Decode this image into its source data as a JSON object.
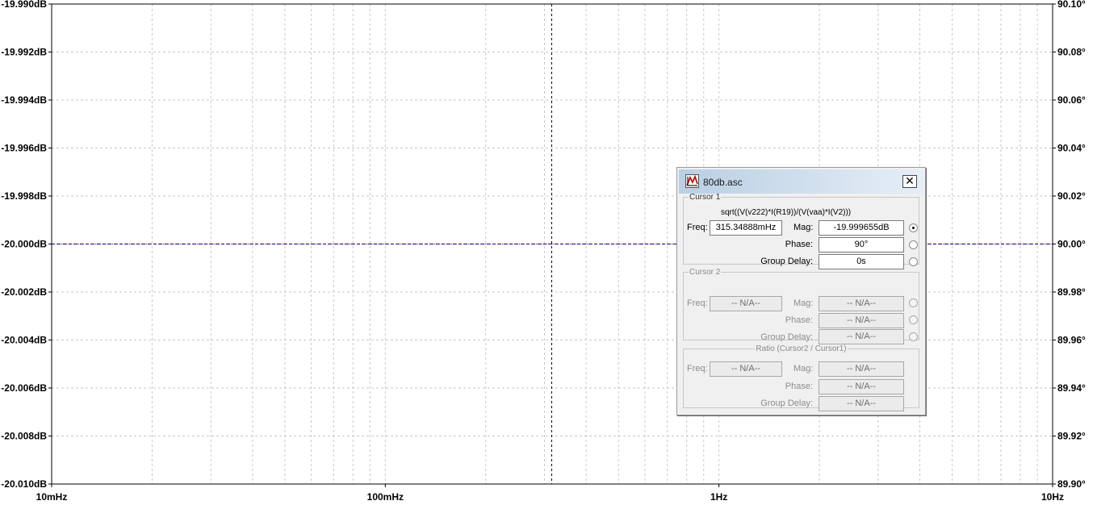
{
  "chart_data": {
    "type": "line",
    "xscale": "log",
    "xlim": [
      0.01,
      10
    ],
    "x_tick_labels": [
      "10mHz",
      "100mHz",
      "1Hz",
      "10Hz"
    ],
    "left_ylim": [
      -20.01,
      -19.99
    ],
    "left_tick_labels": [
      "-19.990dB",
      "-19.992dB",
      "-19.994dB",
      "-19.996dB",
      "-19.998dB",
      "-20.000dB",
      "-20.002dB",
      "-20.004dB",
      "-20.006dB",
      "-20.008dB",
      "-20.010dB"
    ],
    "right_ylim": [
      89.9,
      90.1
    ],
    "right_tick_labels": [
      "90.10°",
      "90.08°",
      "90.06°",
      "90.04°",
      "90.02°",
      "90.00°",
      "89.98°",
      "89.96°",
      "89.94°",
      "89.92°",
      "89.90°"
    ],
    "grid": true,
    "series": [
      {
        "name": "sqrt((V(v222)*I(R19))/(V(vaa)*I(V2)))",
        "quantity": "magnitude",
        "unit": "dB",
        "x": [
          0.01,
          10
        ],
        "y": [
          -20.0,
          -20.0
        ],
        "color": "#b00000",
        "style": "dotted"
      },
      {
        "name": "sqrt((V(v222)*I(R19))/(V(vaa)*I(V2)))",
        "quantity": "phase",
        "unit": "deg",
        "x": [
          0.01,
          10
        ],
        "y": [
          90.0,
          90.0
        ],
        "color": "#000080",
        "style": "dashed"
      }
    ],
    "cursor_x": 0.31534888
  },
  "dialog": {
    "title": "80db.asc",
    "close_glyph": "✕",
    "icon": "ltspice-icon",
    "cursor1": {
      "legend": "Cursor 1",
      "expression": "sqrt((V(v222)*I(R19))/(V(vaa)*I(V2)))",
      "freq_label": "Freq:",
      "freq": "315.34888mHz",
      "mag_label": "Mag:",
      "mag": "-19.999655dB",
      "phase_label": "Phase:",
      "phase": "90°",
      "gd_label": "Group Delay:",
      "gd": "0s"
    },
    "cursor2": {
      "legend": "Cursor 2",
      "freq_label": "Freq:",
      "freq": "-- N/A--",
      "mag_label": "Mag:",
      "mag": "-- N/A--",
      "phase_label": "Phase:",
      "phase": "-- N/A--",
      "gd_label": "Group Delay:",
      "gd": "-- N/A--"
    },
    "ratio": {
      "legend": "Ratio (Cursor2 / Cursor1)",
      "freq_label": "Freq:",
      "freq": "-- N/A--",
      "mag_label": "Mag:",
      "mag": "-- N/A--",
      "phase_label": "Phase:",
      "phase": "-- N/A--",
      "gd_label": "Group Delay:",
      "gd": "-- N/A--"
    }
  }
}
